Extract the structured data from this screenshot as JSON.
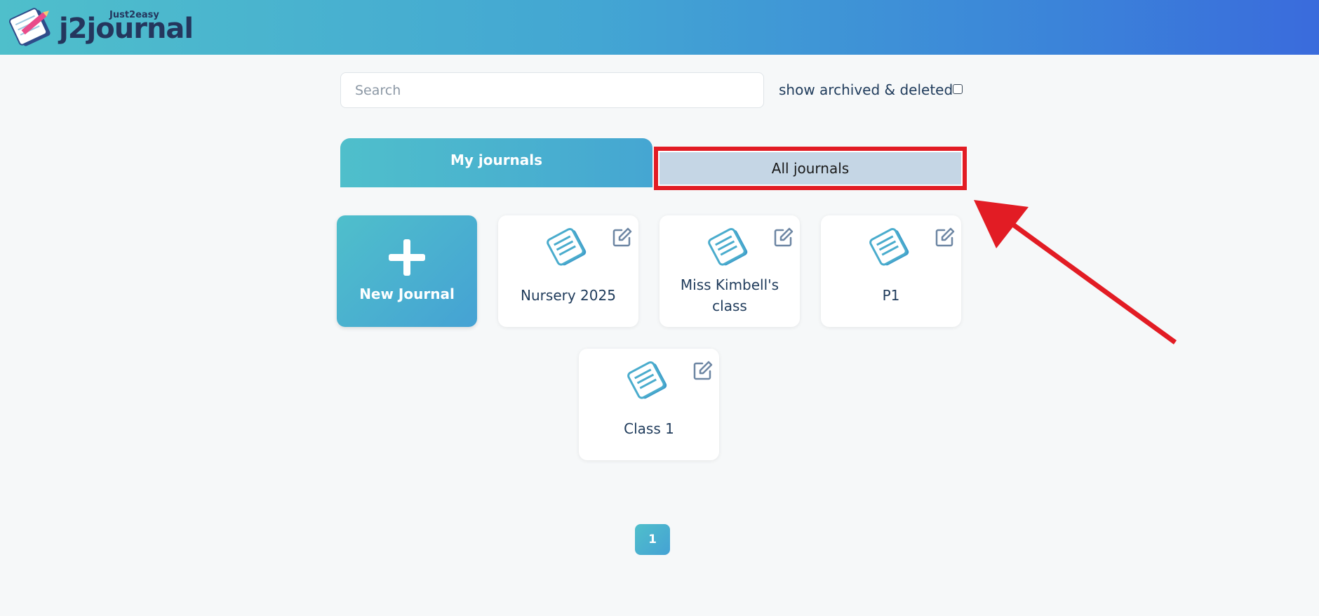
{
  "header": {
    "brand_small": "Just2easy",
    "brand": "j2journal"
  },
  "search": {
    "placeholder": "Search",
    "value": ""
  },
  "filters": {
    "archived_label": "show archived & deleted",
    "archived_checked": false
  },
  "tabs": [
    {
      "label": "My journals",
      "active": true
    },
    {
      "label": "All journals",
      "active": false,
      "highlighted": true
    }
  ],
  "new_journal": {
    "label": "New Journal"
  },
  "journals": [
    {
      "name": "Nursery 2025"
    },
    {
      "name": "Miss Kimbell's",
      "name_line2": "class"
    },
    {
      "name": "P1"
    },
    {
      "name": "Class 1"
    }
  ],
  "pagination": {
    "current": "1"
  },
  "colors": {
    "accent": "#4fbfcb",
    "header_end": "#3a6bdc",
    "highlight": "#e21c24",
    "inactive_tab": "#c5d6e5",
    "text": "#1f3b5b"
  },
  "icons": {
    "logo": "notebook-pencil-icon",
    "journal": "journal-book-icon",
    "edit": "edit-icon",
    "plus": "plus-icon"
  }
}
